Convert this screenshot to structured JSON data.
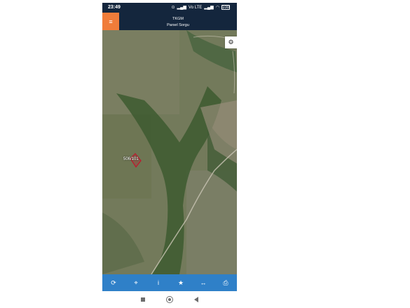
{
  "status_bar": {
    "time": "23:49",
    "signal_text": "Vo LTE",
    "battery_level": "100"
  },
  "header": {
    "title": "TKGM",
    "subtitle": "Parsel Sorgu"
  },
  "map": {
    "parcel_label": "506/101",
    "parcel_color": "#c0162c"
  },
  "toolbar": {
    "items": [
      {
        "icon": "refresh-icon",
        "glyph": "⟳"
      },
      {
        "icon": "locate-icon",
        "glyph": "⌖"
      },
      {
        "icon": "info-icon",
        "glyph": "i"
      },
      {
        "icon": "star-icon",
        "glyph": "★"
      },
      {
        "icon": "measure-icon",
        "glyph": "↔"
      },
      {
        "icon": "print-icon",
        "glyph": "⎙"
      }
    ]
  },
  "colors": {
    "header_bg": "#14263d",
    "menu_accent": "#f07c3a",
    "toolbar_bg": "#2f80c8"
  }
}
